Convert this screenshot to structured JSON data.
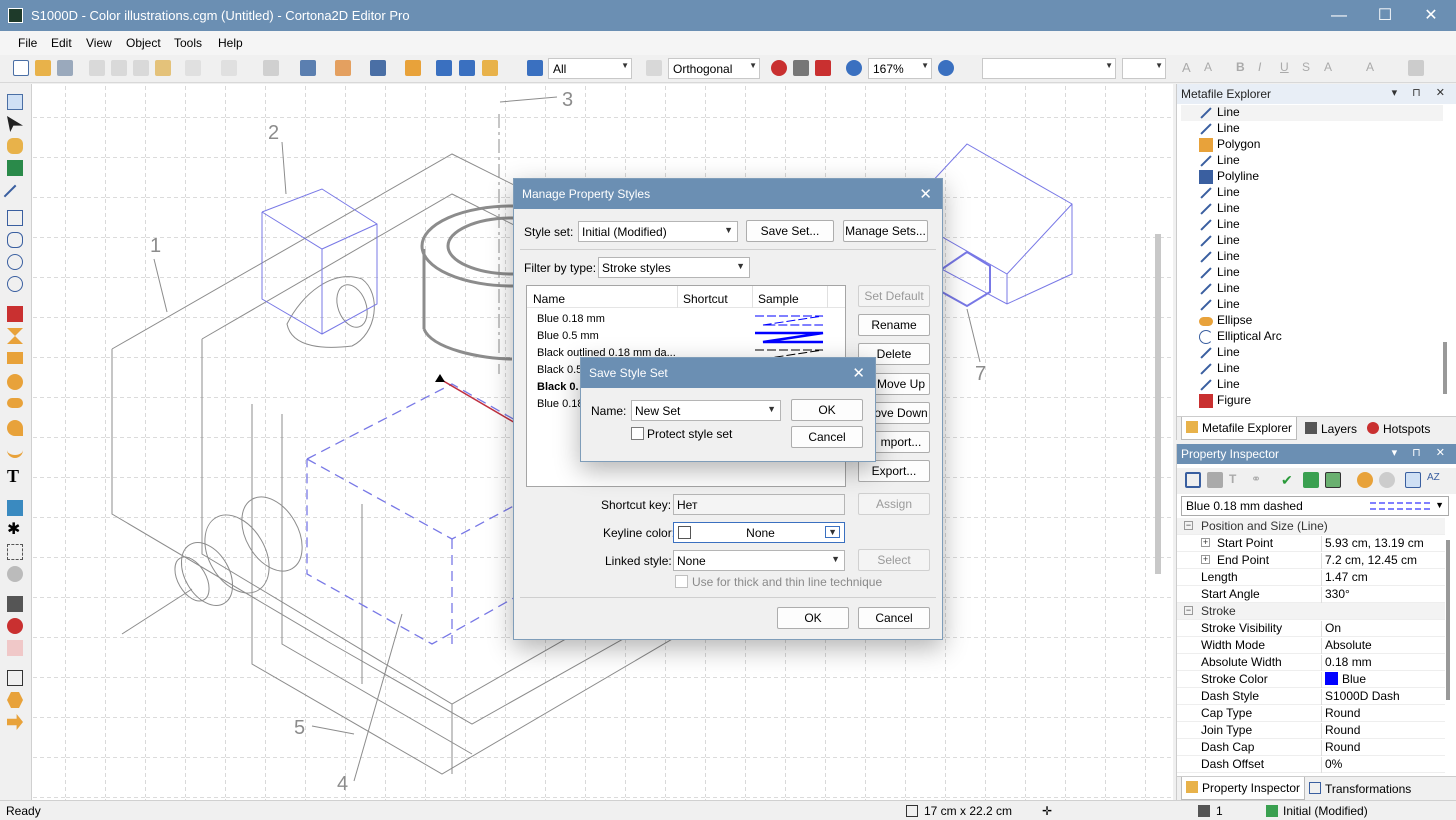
{
  "window": {
    "title": "S1000D - Color illustrations.cgm (Untitled) - Cortona2D Editor Pro",
    "minimize": "—",
    "maximize": "☐",
    "close": "✕"
  },
  "menu": [
    "File",
    "Edit",
    "View",
    "Object",
    "Tools",
    "Help"
  ],
  "toolbar": {
    "filter_value": "All",
    "projection_value": "Orthogonal",
    "zoom_value": "167%"
  },
  "callouts": [
    "1",
    "2",
    "3",
    "4",
    "5",
    "7"
  ],
  "explorer": {
    "title": "Metafile Explorer",
    "items": [
      {
        "label": "Line",
        "icon": "line-icon"
      },
      {
        "label": "Line",
        "icon": "line-icon"
      },
      {
        "label": "Polygon",
        "icon": "polygon-icon"
      },
      {
        "label": "Line",
        "icon": "line-icon"
      },
      {
        "label": "Polyline",
        "icon": "polyline-icon"
      },
      {
        "label": "Line",
        "icon": "line-icon"
      },
      {
        "label": "Line",
        "icon": "line-icon"
      },
      {
        "label": "Line",
        "icon": "line-icon"
      },
      {
        "label": "Line",
        "icon": "line-icon"
      },
      {
        "label": "Line",
        "icon": "line-icon"
      },
      {
        "label": "Line",
        "icon": "line-icon"
      },
      {
        "label": "Line",
        "icon": "line-icon"
      },
      {
        "label": "Line",
        "icon": "line-icon"
      },
      {
        "label": "Ellipse",
        "icon": "ellipse-icon"
      },
      {
        "label": "Elliptical Arc",
        "icon": "arc-icon"
      },
      {
        "label": "Line",
        "icon": "line-icon"
      },
      {
        "label": "Line",
        "icon": "line-icon"
      },
      {
        "label": "Line",
        "icon": "line-icon"
      },
      {
        "label": "Figure",
        "icon": "figure-icon"
      }
    ],
    "tabs": [
      "Metafile Explorer",
      "Layers",
      "Hotspots"
    ]
  },
  "inspector": {
    "title": "Property Inspector",
    "style_value": "Blue 0.18 mm dashed",
    "categories": [
      {
        "name": "Position and Size (Line)",
        "rows": [
          {
            "name": "Start Point",
            "value": "5.93 cm, 13.19 cm",
            "expandable": true
          },
          {
            "name": "End Point",
            "value": "7.2 cm, 12.45 cm",
            "expandable": true
          },
          {
            "name": "Length",
            "value": "1.47 cm"
          },
          {
            "name": "Start Angle",
            "value": "330°"
          }
        ]
      },
      {
        "name": "Stroke",
        "rows": [
          {
            "name": "Stroke Visibility",
            "value": "On"
          },
          {
            "name": "Width Mode",
            "value": "Absolute"
          },
          {
            "name": "Absolute Width",
            "value": "0.18 mm"
          },
          {
            "name": "Stroke Color",
            "value": "Blue",
            "swatch": "#0000ff"
          },
          {
            "name": "Dash Style",
            "value": "S1000D Dash"
          },
          {
            "name": "Cap Type",
            "value": "Round"
          },
          {
            "name": "Join Type",
            "value": "Round"
          },
          {
            "name": "Dash Cap",
            "value": "Round"
          },
          {
            "name": "Dash Offset",
            "value": "0%"
          }
        ]
      }
    ],
    "tabs": [
      "Property Inspector",
      "Transformations"
    ]
  },
  "status": {
    "ready": "Ready",
    "size": "17 cm x 22.2 cm",
    "layer": "1",
    "style_set": "Initial (Modified)"
  },
  "dialog_manage": {
    "title": "Manage Property Styles",
    "style_set_label": "Style set:",
    "style_set_value": "Initial (Modified)",
    "save_set": "Save Set...",
    "manage_sets": "Manage Sets...",
    "filter_label": "Filter by type:",
    "filter_value": "Stroke styles",
    "columns": [
      "Name",
      "Shortcut",
      "Sample"
    ],
    "rows": [
      {
        "name": "Blue 0.18 mm",
        "bold": false
      },
      {
        "name": "Blue 0.5 mm",
        "bold": false
      },
      {
        "name": "Black outlined 0.18 mm da...",
        "bold": false
      },
      {
        "name": "Black 0.5",
        "bold": false
      },
      {
        "name": "Black 0.",
        "bold": true
      },
      {
        "name": "Blue 0.18",
        "bold": false
      }
    ],
    "buttons": {
      "set_default": "Set Default",
      "rename": "Rename",
      "delete": "Delete",
      "move_up": "Move Up",
      "move_down": "ove Down",
      "import": "mport...",
      "export": "Export..."
    },
    "shortcut_label": "Shortcut key:",
    "shortcut_value": "Нет",
    "assign": "Assign",
    "keyline_label": "Keyline color:",
    "keyline_value": "None",
    "linked_label": "Linked style:",
    "linked_value": "None",
    "select": "Select",
    "thick_thin": "Use for thick and thin line technique",
    "ok": "OK",
    "cancel": "Cancel"
  },
  "dialog_save": {
    "title": "Save Style Set",
    "name_label": "Name:",
    "name_value": "New Set",
    "protect": "Protect style set",
    "ok": "OK",
    "cancel": "Cancel"
  },
  "colors": {
    "title_bar": "#6b8fb3",
    "accent_blue": "#0000ff",
    "drawing_blue": "#7878e6",
    "drawing_gray": "#8c8c8c"
  }
}
